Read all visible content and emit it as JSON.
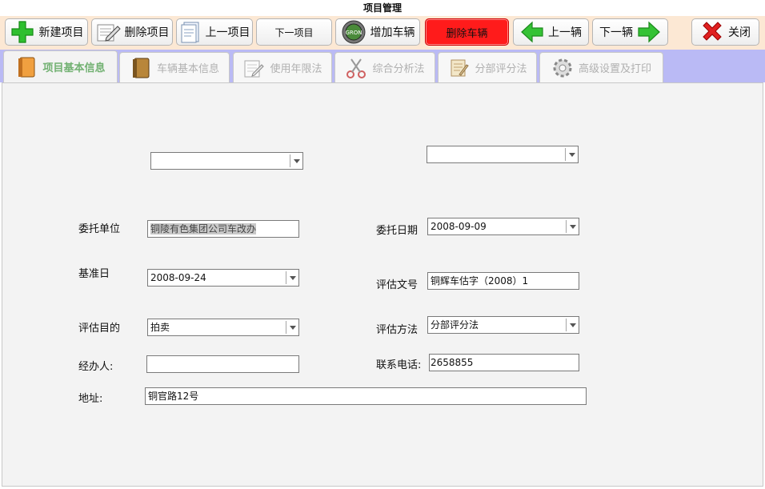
{
  "window": {
    "title": "项目管理"
  },
  "toolbar": {
    "new_project": "新建项目",
    "delete_project": "删除项目",
    "prev_project": "上一项目",
    "next_project": "下一项目",
    "add_vehicle": "增加车辆",
    "delete_vehicle": "删除车辆",
    "prev_vehicle": "上一辆",
    "next_vehicle": "下一辆",
    "close": "关闭"
  },
  "tabs": [
    {
      "label": "项目基本信息",
      "icon": "book-icon"
    },
    {
      "label": "车辆基本信息",
      "icon": "book-icon"
    },
    {
      "label": "使用年限法",
      "icon": "notepad-icon"
    },
    {
      "label": "综合分析法",
      "icon": "scissors-icon"
    },
    {
      "label": "分部评分法",
      "icon": "scroll-icon"
    },
    {
      "label": "高级设置及打印",
      "icon": "gear-icon"
    }
  ],
  "form": {
    "top_combo_left": "",
    "top_combo_right": "",
    "client_label": "委托单位",
    "client_value": "铜陵有色集团公司车改办",
    "entrust_date_label": "委托日期",
    "entrust_date_value": "2008-09-09",
    "base_date_label": "基准日",
    "base_date_value": "2008-09-24",
    "doc_no_label": "评估文号",
    "doc_no_value": "铜辉车估字（2008）1",
    "purpose_label": "评估目的",
    "purpose_value": "拍卖",
    "method_label": "评估方法",
    "method_value": "分部评分法",
    "handler_label": "经办人:",
    "handler_value": "",
    "phone_label": "联系电话:",
    "phone_value": "2658855",
    "address_label": "地址:",
    "address_value": "铜官路12号"
  },
  "colors": {
    "toolbar_bg": "#fce8d4",
    "tabbar_bg": "#babaf5",
    "active_tab_text": "#72b172",
    "delete_vehicle_bg": "#ff1b1b"
  }
}
